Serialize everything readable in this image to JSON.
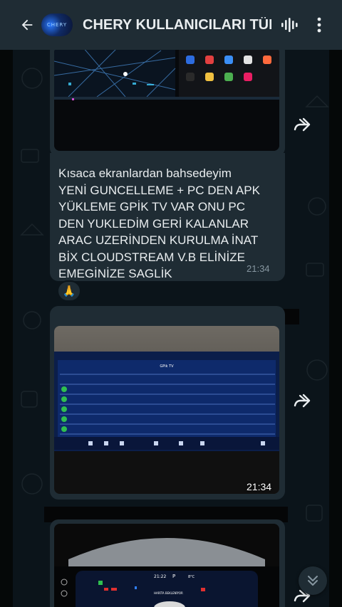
{
  "header": {
    "title": "CHERY KULLANICILARI TÜR...",
    "avatar_text": "CHERY"
  },
  "messages": [
    {
      "type": "image",
      "content": "car display screenshot with map and app grid"
    },
    {
      "type": "text",
      "text": "Kısaca ekranlardan bahsedeyim\nYENİ GUNCELLEME + PC DEN APK\nYÜKLEME GPİK TV VAR ONU PC\nDEN YUKLEDİM GERİ KALANLAR\nARAC UZERİNDEN KURULMA İNAT\nBİX CLOUDSTREAM V.B ELİNİZE\nEMEGİNİZE SAGLİK",
      "time": "21:34",
      "reaction": "🙏"
    },
    {
      "type": "image",
      "content": "car display showing GPik TV app list",
      "time": "21:34",
      "screen_title": "GPik TV"
    },
    {
      "type": "image",
      "content": "car instrument cluster",
      "cluster_time": "21:22",
      "cluster_gear": "P",
      "cluster_temp": "8°C",
      "cluster_message": "HARİTA BEKLENİYOR"
    }
  ],
  "colors": {
    "background": "#0b141a",
    "bubble": "#1f2c34",
    "header": "#1f2c34",
    "text": "#e9edef",
    "muted": "#8696a0"
  }
}
